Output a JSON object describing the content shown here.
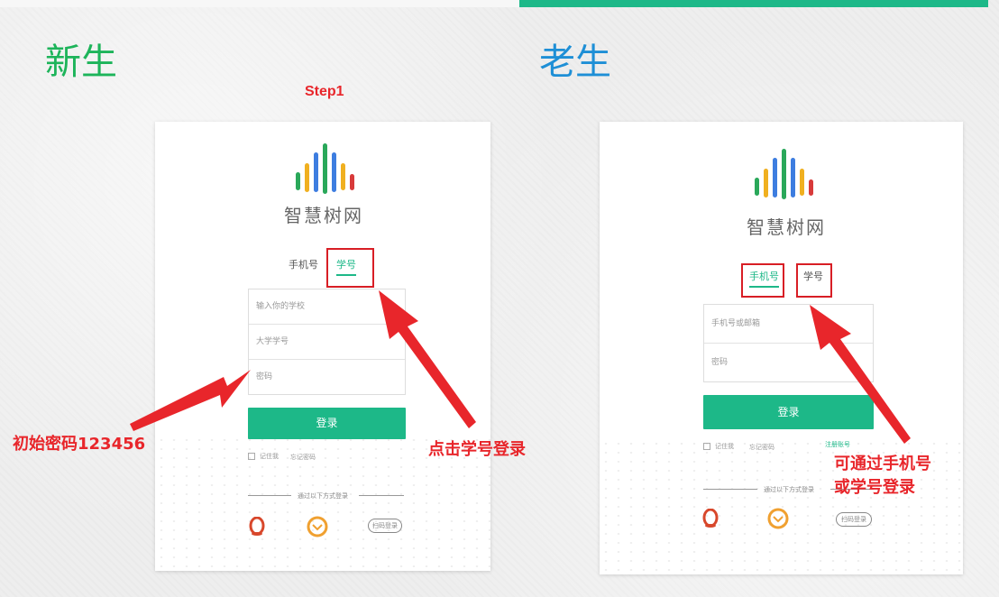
{
  "left_panel": {
    "heading": "新生",
    "step_label": "Step1",
    "brand": "智慧树网",
    "tabs": [
      "手机号",
      "学号"
    ],
    "active_tab": 1,
    "fields": [
      "输入你的学校",
      "大学学号",
      "密码"
    ],
    "login_button": "登录",
    "remember": "记住我",
    "forgot": "忘记密码",
    "other_login": "通过以下方式登录",
    "scan_label": "扫码登录",
    "annotation_password": "初始密码123456",
    "annotation_tab": "点击学号登录"
  },
  "right_panel": {
    "heading": "老生",
    "brand": "智慧树网",
    "tabs": [
      "手机号",
      "学号"
    ],
    "active_tab": 0,
    "fields": [
      "手机号或邮箱",
      "密码"
    ],
    "login_button": "登录",
    "remember": "记住我",
    "forgot": "忘记密码",
    "register": "注册账号",
    "other_login": "通过以下方式登录",
    "scan_label": "扫码登录",
    "annotation_tab_line1": "可通过手机号",
    "annotation_tab_line2": "或学号登录"
  },
  "colors": {
    "accent": "#1db888",
    "heading_new": "#1db45a",
    "heading_old": "#1e8fd6",
    "annotation": "#e8262b"
  },
  "icons": [
    "logo-bars-icon",
    "qq-icon",
    "wechat-icon",
    "arrow-icon"
  ]
}
